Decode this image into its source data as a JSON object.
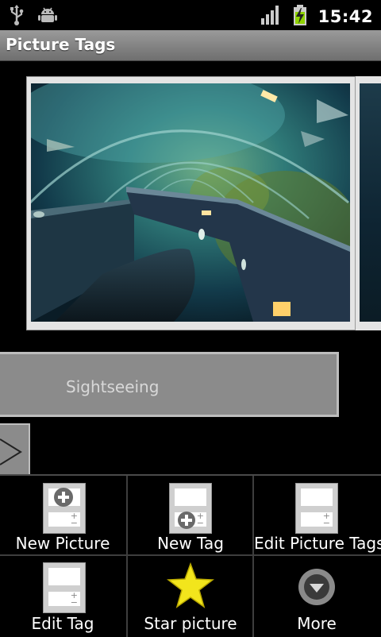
{
  "status_bar": {
    "time": "15:42",
    "left_icons": [
      "usb-icon",
      "android-debug-icon"
    ],
    "right_icons": [
      "signal-icon",
      "battery-charging-icon"
    ]
  },
  "app": {
    "title": "Picture Tags"
  },
  "gallery": {
    "current_photo": "aquarium-tunnel-photo"
  },
  "tag": {
    "label": "Sightseeing"
  },
  "menu": {
    "items": [
      {
        "label": "New Picture",
        "icon": "new-picture-icon"
      },
      {
        "label": "New Tag",
        "icon": "new-tag-icon"
      },
      {
        "label": "Edit Picture Tags",
        "icon": "edit-picture-tags-icon"
      },
      {
        "label": "Edit Tag",
        "icon": "edit-tag-icon"
      },
      {
        "label": "Star picture",
        "icon": "star-icon"
      },
      {
        "label": "More",
        "icon": "more-icon"
      }
    ]
  },
  "colors": {
    "title_bar": "#808080",
    "star": "#f2e51c",
    "tag_button": "#8b8b8b"
  }
}
